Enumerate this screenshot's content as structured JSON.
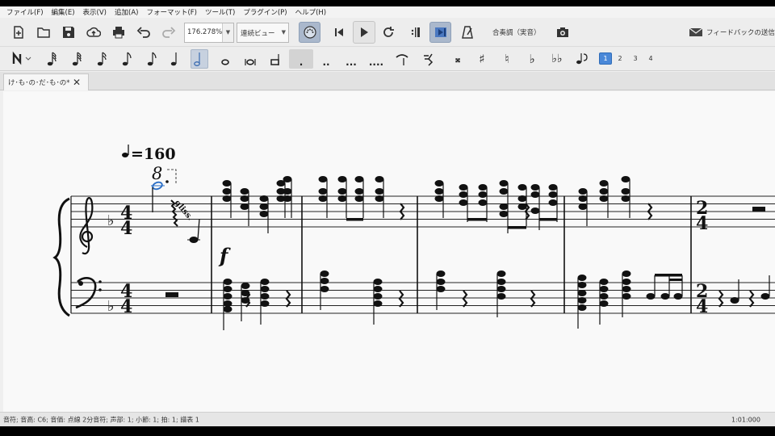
{
  "menu": [
    "ファイル(F)",
    "編集(E)",
    "表示(V)",
    "追加(A)",
    "フォーマット(F)",
    "ツール(T)",
    "プラグイン(P)",
    "ヘルプ(H)"
  ],
  "toolbar": {
    "zoom_value": "176.278%",
    "view_mode": "連続ビュー",
    "concert_pitch_label": "合奏調（実音）",
    "feedback_label": "フィードバックの送信"
  },
  "note_input": {
    "voices": [
      "1",
      "2",
      "3",
      "4"
    ],
    "active_voice": "1",
    "dots": [
      ".",
      "..",
      "...",
      "...."
    ]
  },
  "tab": {
    "title": "け･も･の･だ･も･の*"
  },
  "score": {
    "tempo_text": "=160",
    "octave_mark": "8",
    "gliss_text": "gliss.",
    "dynamic": "f",
    "time_signature_first": [
      "4",
      "4"
    ],
    "time_signature_change": [
      "2",
      "4"
    ]
  },
  "status": {
    "text": "音符; 音高: C6; 音価: 点線 2分音符; 声部: 1;  小節: 1; 拍: 1; 譜表 1",
    "time": "1:01:000"
  }
}
